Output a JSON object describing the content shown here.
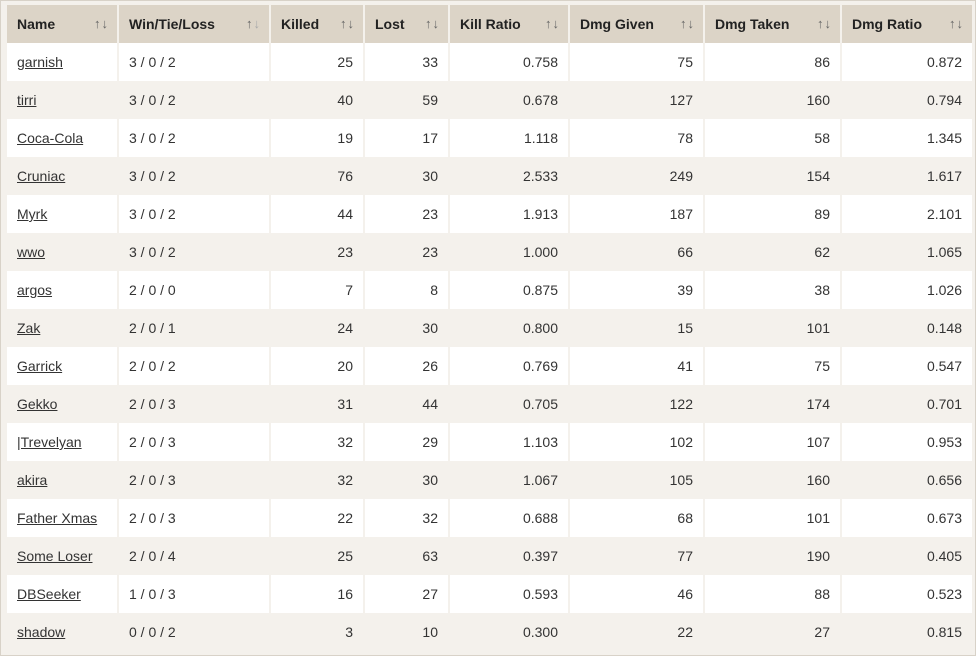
{
  "columns": [
    {
      "label": "Name",
      "align": "left"
    },
    {
      "label": "Win/Tie/Loss",
      "align": "left"
    },
    {
      "label": "Killed",
      "align": "right"
    },
    {
      "label": "Lost",
      "align": "right"
    },
    {
      "label": "Kill Ratio",
      "align": "right"
    },
    {
      "label": "Dmg Given",
      "align": "right"
    },
    {
      "label": "Dmg Taken",
      "align": "right"
    },
    {
      "label": "Dmg Ratio",
      "align": "right"
    }
  ],
  "sort_icons": {
    "asc": "↑",
    "desc": "↓"
  },
  "rows": [
    [
      "garnish",
      "3 / 0 / 2",
      "25",
      "33",
      "0.758",
      "75",
      "86",
      "0.872"
    ],
    [
      "tirri",
      "3 / 0 / 2",
      "40",
      "59",
      "0.678",
      "127",
      "160",
      "0.794"
    ],
    [
      "Coca-Cola",
      "3 / 0 / 2",
      "19",
      "17",
      "1.118",
      "78",
      "58",
      "1.345"
    ],
    [
      "Cruniac",
      "3 / 0 / 2",
      "76",
      "30",
      "2.533",
      "249",
      "154",
      "1.617"
    ],
    [
      "Myrk",
      "3 / 0 / 2",
      "44",
      "23",
      "1.913",
      "187",
      "89",
      "2.101"
    ],
    [
      "wwo",
      "3 / 0 / 2",
      "23",
      "23",
      "1.000",
      "66",
      "62",
      "1.065"
    ],
    [
      "argos",
      "2 / 0 / 0",
      "7",
      "8",
      "0.875",
      "39",
      "38",
      "1.026"
    ],
    [
      "Zak",
      "2 / 0 / 1",
      "24",
      "30",
      "0.800",
      "15",
      "101",
      "0.148"
    ],
    [
      "Garrick",
      "2 / 0 / 2",
      "20",
      "26",
      "0.769",
      "41",
      "75",
      "0.547"
    ],
    [
      "Gekko",
      "2 / 0 / 3",
      "31",
      "44",
      "0.705",
      "122",
      "174",
      "0.701"
    ],
    [
      "|Trevelyan",
      "2 / 0 / 3",
      "32",
      "29",
      "1.103",
      "102",
      "107",
      "0.953"
    ],
    [
      "akira",
      "2 / 0 / 3",
      "32",
      "30",
      "1.067",
      "105",
      "160",
      "0.656"
    ],
    [
      "Father Xmas",
      "2 / 0 / 3",
      "22",
      "32",
      "0.688",
      "68",
      "101",
      "0.673"
    ],
    [
      "Some Loser",
      "2 / 0 / 4",
      "25",
      "63",
      "0.397",
      "77",
      "190",
      "0.405"
    ],
    [
      "DBSeeker",
      "1 / 0 / 3",
      "16",
      "27",
      "0.593",
      "46",
      "88",
      "0.523"
    ],
    [
      "shadow",
      "0 / 0 / 2",
      "3",
      "10",
      "0.300",
      "22",
      "27",
      "0.815"
    ]
  ]
}
